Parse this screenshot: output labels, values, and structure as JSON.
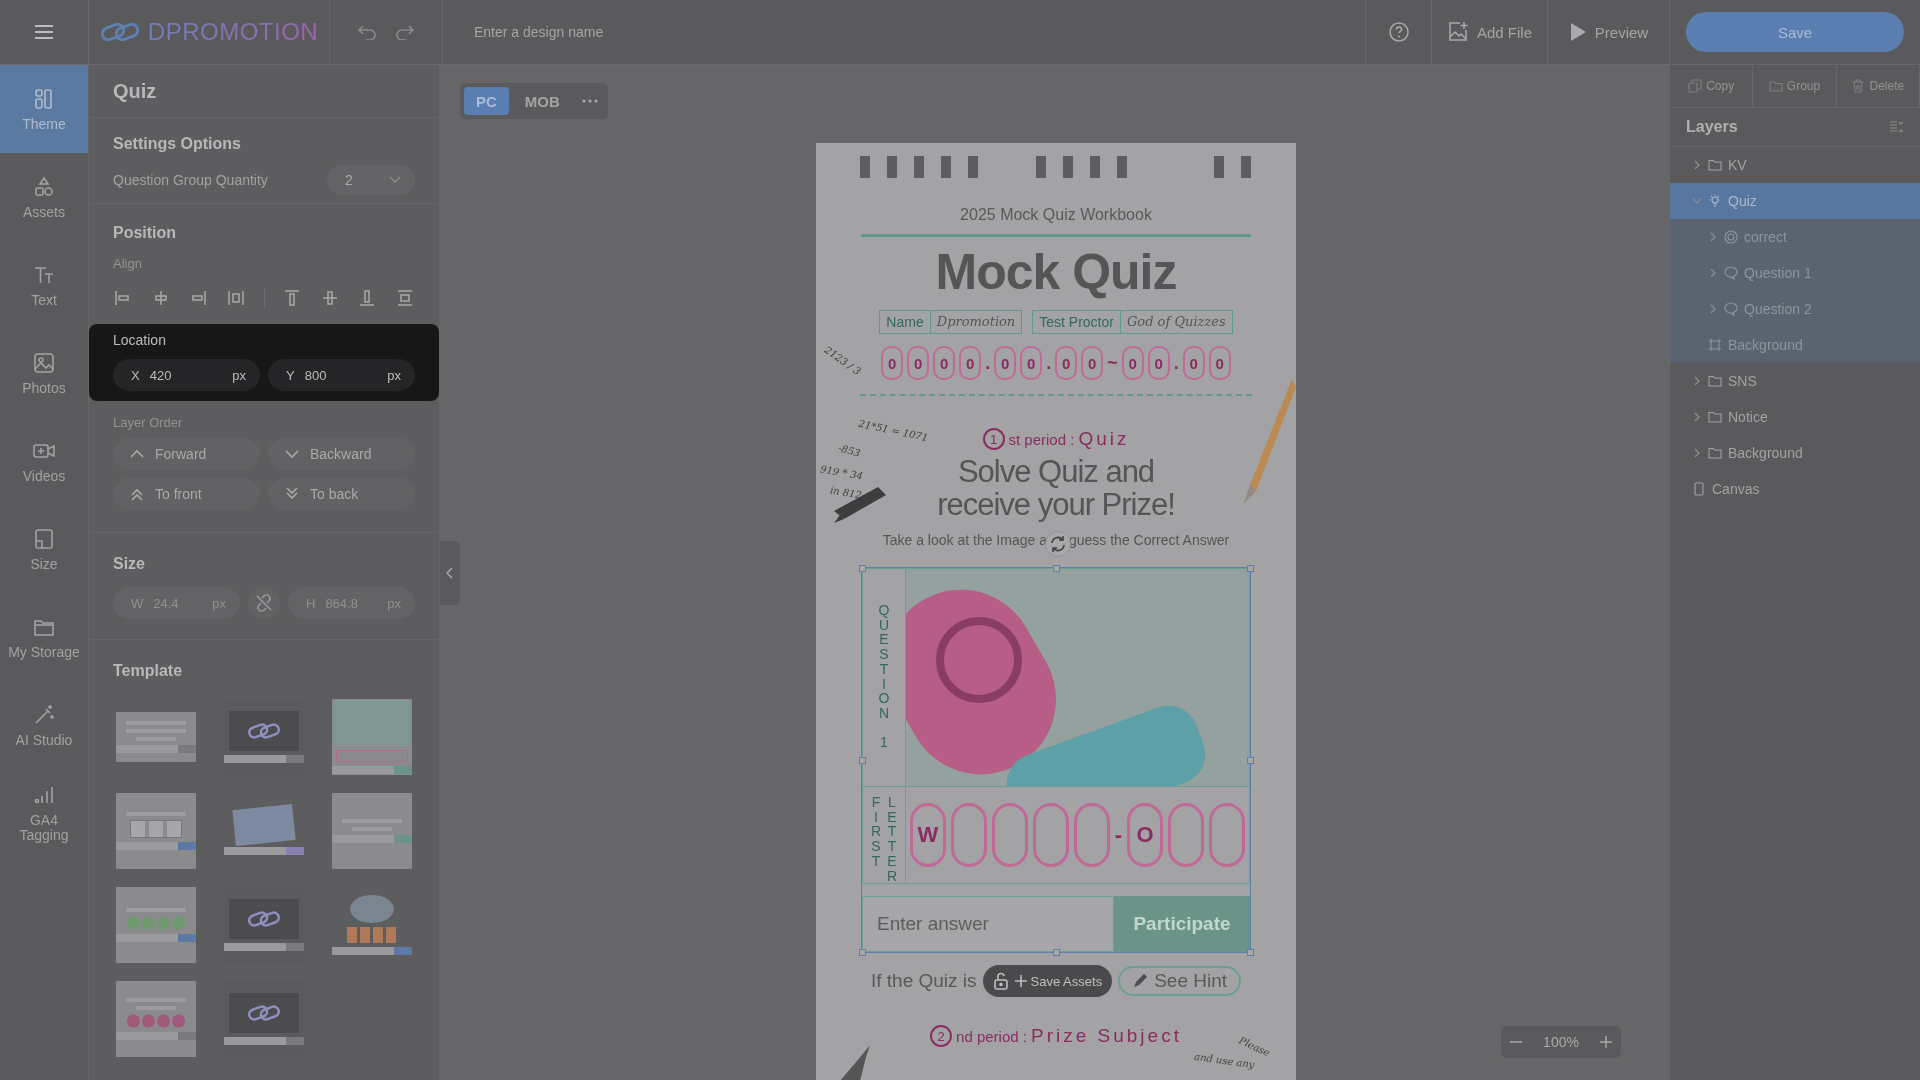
{
  "top_bar": {
    "brand": "DPROMOTION",
    "design_name": {
      "placeholder": "Enter a design name"
    },
    "actions": [
      {
        "kind": "add-file",
        "label": "Add File"
      },
      {
        "kind": "preview",
        "label": "Preview"
      }
    ],
    "save": "Save"
  },
  "rail": [
    {
      "kind": "theme",
      "label": "Theme",
      "selected": true
    },
    {
      "kind": "assets",
      "label": "Assets",
      "selected": false
    },
    {
      "kind": "text",
      "label": "Text",
      "selected": false
    },
    {
      "kind": "photos",
      "label": "Photos",
      "selected": false
    },
    {
      "kind": "videos",
      "label": "Videos",
      "selected": false
    },
    {
      "kind": "size",
      "label": "Size",
      "selected": false
    },
    {
      "kind": "storage",
      "label": "My Storage",
      "selected": false
    },
    {
      "kind": "ai",
      "label": "AI Studio",
      "selected": false
    },
    {
      "kind": "analytics",
      "label": "GA4 Tagging",
      "selected": false
    }
  ],
  "settings": {
    "title": "Quiz",
    "options_heading": "Settings Options",
    "quantity": {
      "label": "Question Group Quantity",
      "value": "2"
    },
    "position_heading": "Position",
    "align_label": "Align",
    "location": {
      "label": "Location",
      "x": {
        "axis": "X",
        "value": "420",
        "unit": "px"
      },
      "y": {
        "axis": "Y",
        "value": "800",
        "unit": "px"
      }
    },
    "layer_order": {
      "label": "Layer Order",
      "buttons": [
        {
          "kind": "up",
          "label": "Forward"
        },
        {
          "kind": "down",
          "label": "Backward"
        },
        {
          "kind": "top",
          "label": "To front"
        },
        {
          "kind": "bottom",
          "label": "To back"
        }
      ]
    },
    "size": {
      "heading": "Size",
      "w": {
        "axis": "W",
        "value": "24.4",
        "unit": "px"
      },
      "h": {
        "axis": "H",
        "value": "864.8",
        "unit": "px"
      }
    },
    "template_heading": "Template",
    "templates": [
      {
        "kind": "form"
      },
      {
        "kind": "logo"
      },
      {
        "kind": "photo"
      },
      {
        "kind": "letters"
      },
      {
        "kind": "map"
      },
      {
        "kind": "text"
      },
      {
        "kind": "circles"
      },
      {
        "kind": "logo"
      },
      {
        "kind": "puzzle"
      },
      {
        "kind": "event"
      },
      {
        "kind": "logo"
      }
    ]
  },
  "device_tabs": [
    {
      "label": "PC",
      "selected": true
    },
    {
      "label": "MOB",
      "selected": false
    }
  ],
  "page": {
    "subtitle": "2025 Mock Quiz Workbook",
    "title": "Mock Quiz",
    "fields": [
      {
        "label": "Name",
        "value": "Dpromotion"
      },
      {
        "label": "Test Proctor",
        "value": "God of Quizzes"
      }
    ],
    "date_slots": [
      {
        "kind": "digit",
        "text": "0"
      },
      {
        "kind": "digit",
        "text": "0"
      },
      {
        "kind": "digit",
        "text": "0"
      },
      {
        "kind": "digit",
        "text": "0"
      },
      {
        "kind": "separator",
        "text": "."
      },
      {
        "kind": "digit",
        "text": "0"
      },
      {
        "kind": "digit",
        "text": "0"
      },
      {
        "kind": "separator",
        "text": "."
      },
      {
        "kind": "digit",
        "text": "0"
      },
      {
        "kind": "digit",
        "text": "0"
      },
      {
        "kind": "separator",
        "text": "~"
      },
      {
        "kind": "digit",
        "text": "0"
      },
      {
        "kind": "digit",
        "text": "0"
      },
      {
        "kind": "separator",
        "text": "."
      },
      {
        "kind": "digit",
        "text": "0"
      },
      {
        "kind": "digit",
        "text": "0"
      }
    ],
    "period1": {
      "number": "1",
      "text": "st period :",
      "label": "Quiz"
    },
    "headline": [
      "Solve Quiz and",
      "receive your Prize!"
    ],
    "instruction": {
      "before": "Take a look at the Image a",
      "after": "guess the Correct Answer"
    },
    "question_label": "QUESTION 1",
    "letter_label": [
      "FIRST",
      "LETTER"
    ],
    "answer_slots": [
      {
        "kind": "slot",
        "text": "W"
      },
      {
        "kind": "slot"
      },
      {
        "kind": "slot"
      },
      {
        "kind": "slot"
      },
      {
        "kind": "slot"
      },
      {
        "kind": "separator",
        "text": "-"
      },
      {
        "kind": "slot",
        "text": "O"
      },
      {
        "kind": "slot"
      },
      {
        "kind": "slot"
      }
    ],
    "answer_field": {
      "placeholder": "Enter answer"
    },
    "submit": "Participate",
    "hint_text": "If the Quiz is",
    "hint_button": "See Hint",
    "period2": {
      "number": "2",
      "text": "nd period :",
      "label": "Prize Subject"
    },
    "scribbles": [
      "2123 / 3",
      "21*51 = 1071",
      "-853",
      "919 * 34",
      "in 812",
      "Please",
      "and use any"
    ]
  },
  "floating_toolbar": {
    "label": "Save Assets"
  },
  "zoom": {
    "value": "100%"
  },
  "layers": {
    "actions": [
      {
        "kind": "copy",
        "label": "Copy"
      },
      {
        "kind": "group",
        "label": "Group"
      },
      {
        "kind": "delete",
        "label": "Delete"
      }
    ],
    "title": "Layers",
    "items": [
      {
        "kind": "folder",
        "label": "KV",
        "selected": false,
        "expanded": false
      },
      {
        "kind": "quiz",
        "label": "Quiz",
        "selected": true,
        "expanded": true,
        "children": [
          {
            "kind": "target",
            "label": "correct",
            "selected": false,
            "expanded": false
          },
          {
            "kind": "question",
            "label": "Question 1",
            "selected": false,
            "expanded": false
          },
          {
            "kind": "question",
            "label": "Question 2",
            "selected": false,
            "expanded": false
          },
          {
            "kind": "frame",
            "label": "Background",
            "selected": false
          }
        ]
      },
      {
        "kind": "folder",
        "label": "SNS",
        "selected": false,
        "expanded": false
      },
      {
        "kind": "folder",
        "label": "Notice",
        "selected": false,
        "expanded": false
      },
      {
        "kind": "folder",
        "label": "Background",
        "selected": false,
        "expanded": false
      },
      {
        "kind": "canvas",
        "label": "Canvas",
        "selected": false
      }
    ]
  }
}
